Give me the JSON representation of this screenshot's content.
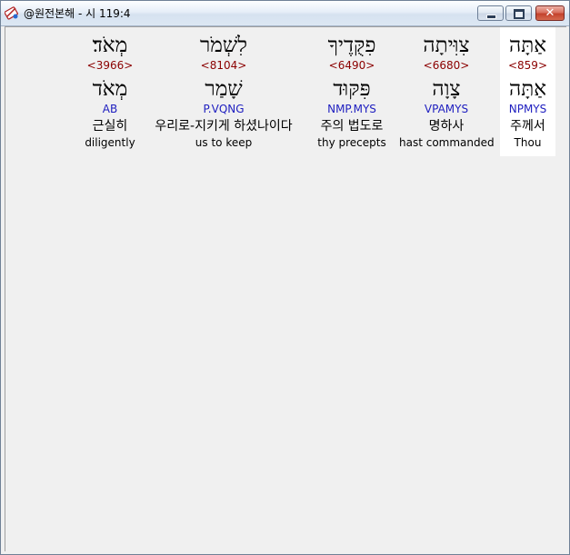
{
  "window": {
    "title": "@원전본해 - 시 119:4",
    "controls": {
      "minimize": "minimize",
      "maximize": "maximize",
      "close": "✕"
    }
  },
  "words": [
    {
      "hebrew": "אַתָּה",
      "strong": "<859>",
      "root": "אַתָּה",
      "parsing": "NPMYS",
      "korean": "주께서",
      "english": "Thou"
    },
    {
      "hebrew": "צִוִּיתָה",
      "strong": "<6680>",
      "root": "צָוָה",
      "parsing": "VPAMYS",
      "korean": "명하사",
      "english": "hast commanded"
    },
    {
      "hebrew": "פִקֻּדֶיךָ",
      "strong": "<6490>",
      "root": "פִּקּוּד",
      "parsing": "NMP.MYS",
      "korean": "주의 법도로",
      "english": "thy precepts"
    },
    {
      "hebrew": "לִשְׁמֹר",
      "strong": "<8104>",
      "root": "שָׁמַר",
      "parsing": "P.VQNG",
      "korean": "우리로-지키게 하셨나이다",
      "english": "us to keep"
    },
    {
      "hebrew": "מְאֹד׃",
      "strong": "<3966>",
      "root": "מְאֹד",
      "parsing": "AB",
      "korean": "근실히",
      "english": "diligently"
    }
  ],
  "colors": {
    "strong": "#8b0000",
    "parsing": "#2020c0",
    "selected_bg": "#ffffff",
    "client_bg": "#f0f0f0"
  }
}
